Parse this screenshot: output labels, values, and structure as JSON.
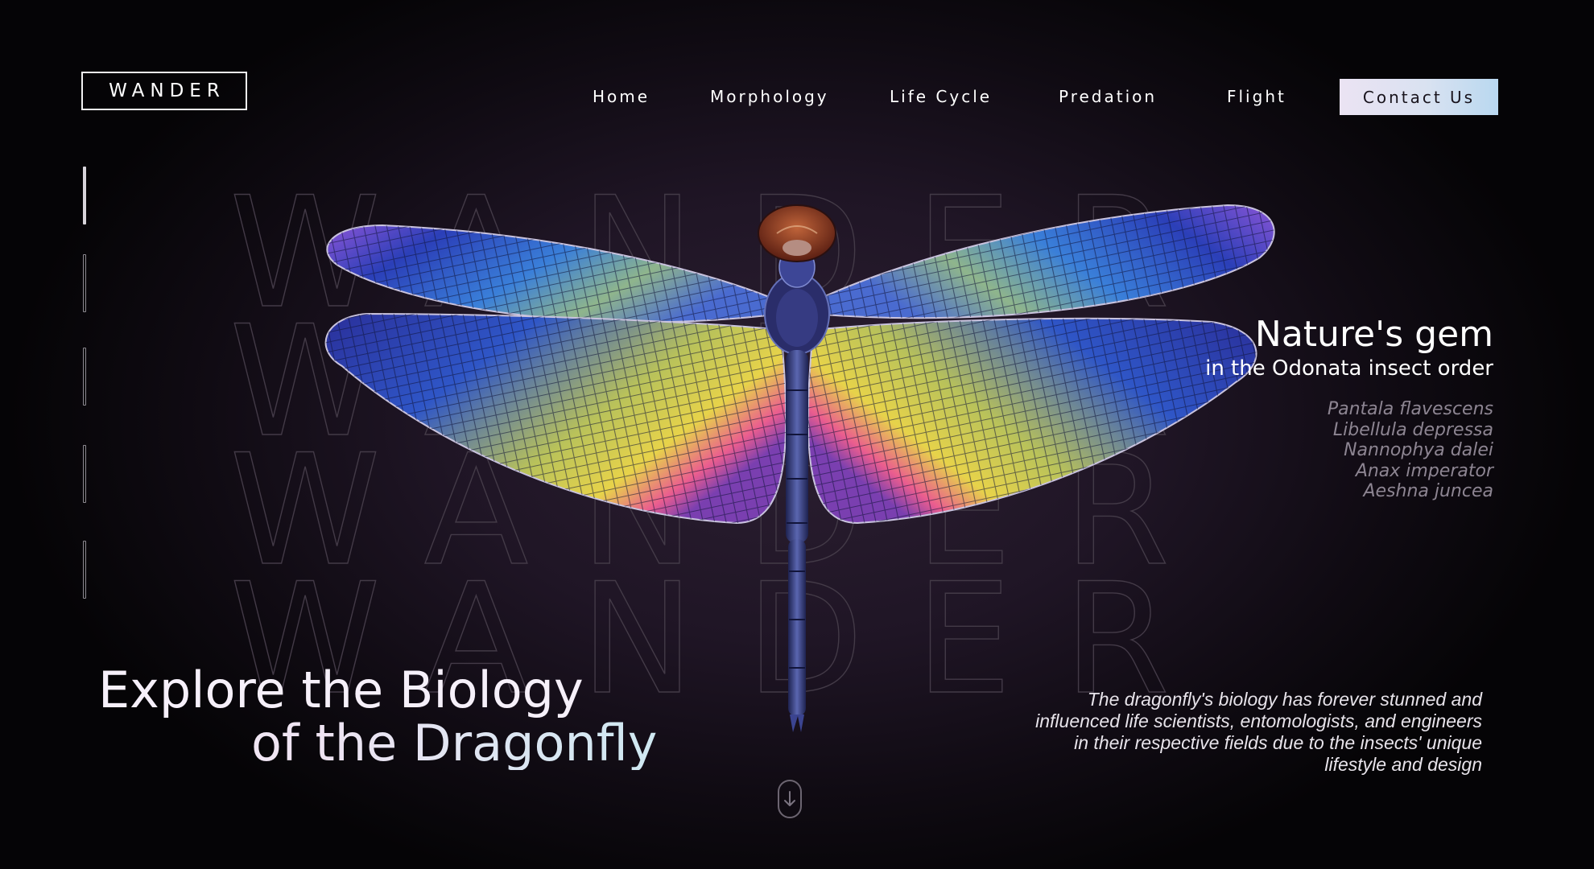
{
  "brand": {
    "logo_text": "WANDER",
    "watermark_lines": [
      "WANDER",
      "WANDER",
      "WANDER",
      "WANDER"
    ]
  },
  "nav": {
    "items": [
      {
        "label": "Home"
      },
      {
        "label": "Morphology"
      },
      {
        "label": "Life Cycle"
      },
      {
        "label": "Predation"
      },
      {
        "label": "Flight"
      }
    ],
    "contact_label": "Contact Us"
  },
  "side_indicators": {
    "count": 5,
    "active_index": 0
  },
  "hero": {
    "title_line1": "Explore the Biology",
    "title_line2": "of the Dragonfly"
  },
  "feature": {
    "title": "Nature's gem",
    "subtitle": "in the Odonata insect order",
    "species": [
      "Pantala flavescens",
      "Libellula depressa",
      "Nannophya dalei",
      "Anax imperator",
      "Aeshna juncea"
    ]
  },
  "description": "The dragonfly's biology has forever stunned and influenced life scientists, entomologists, and engineers in their respective fields due to the insects' unique lifestyle and design",
  "icons": {
    "scroll": "arrow-down-icon",
    "subject": "dragonfly"
  },
  "colors": {
    "background": "#1f1525",
    "contact_gradient_start": "#ebe3f3",
    "contact_gradient_end": "#b9d8f0",
    "species_text": "#8d8592"
  }
}
